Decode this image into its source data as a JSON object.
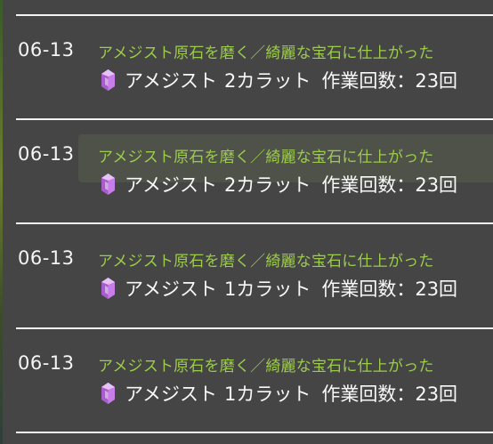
{
  "log": {
    "entries": [
      {
        "date": "06-13",
        "action": "アメジスト原石を磨く／綺麗な宝石に仕上がった",
        "item_name": "アメジスト",
        "carat": "2カラット",
        "work_count_label": "作業回数：23回",
        "icon": "amethyst-gem-icon"
      },
      {
        "date": "06-13",
        "action": "アメジスト原石を磨く／綺麗な宝石に仕上がった",
        "item_name": "アメジスト",
        "carat": "2カラット",
        "work_count_label": "作業回数：23回",
        "icon": "amethyst-gem-icon"
      },
      {
        "date": "06-13",
        "action": "アメジスト原石を磨く／綺麗な宝石に仕上がった",
        "item_name": "アメジスト",
        "carat": "1カラット",
        "work_count_label": "作業回数：23回",
        "icon": "amethyst-gem-icon"
      },
      {
        "date": "06-13",
        "action": "アメジスト原石を磨く／綺麗な宝石に仕上がった",
        "item_name": "アメジスト",
        "carat": "1カラット",
        "work_count_label": "作業回数：23回",
        "icon": "amethyst-gem-icon"
      }
    ]
  },
  "colors": {
    "background": "#454545",
    "action_text": "#9ccc4a",
    "primary_text": "#f5f5f5",
    "divider": "#f2f2f2",
    "gem": "#c77ee8",
    "highlight_row": "#4e5249"
  }
}
